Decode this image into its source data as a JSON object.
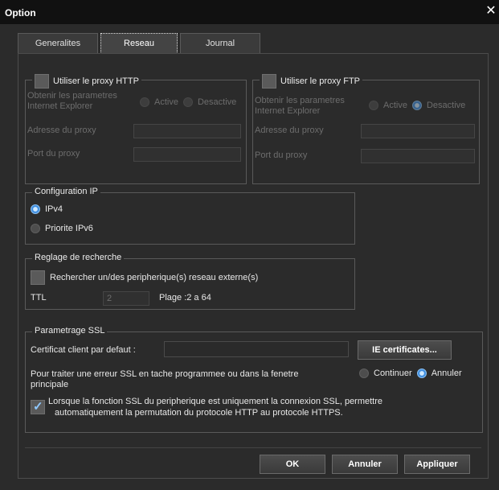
{
  "window": {
    "title": "Option",
    "close_glyph": "✕"
  },
  "tabs": [
    {
      "label": "Generalites"
    },
    {
      "label": "Reseau"
    },
    {
      "label": "Journal"
    }
  ],
  "proxy_http": {
    "checkbox_label": "Utiliser le proxy HTTP",
    "obtain_label_1": "Obtenir les parametres",
    "obtain_label_2": "Internet Explorer",
    "active_label": "Active",
    "desactive_label": "Desactive",
    "address_label": "Adresse du proxy",
    "port_label": "Port du proxy"
  },
  "proxy_ftp": {
    "checkbox_label": "Utiliser le proxy FTP",
    "obtain_label_1": "Obtenir les parametres",
    "obtain_label_2": "Internet Explorer",
    "active_label": "Active",
    "desactive_label": "Desactive",
    "address_label": "Adresse du proxy",
    "port_label": "Port du proxy"
  },
  "ip_config": {
    "legend": "Configuration IP",
    "ipv4_label": "IPv4",
    "ipv6_label": "Priorite IPv6"
  },
  "search": {
    "legend": "Reglage de recherche",
    "external_label": "Rechercher un/des peripherique(s) reseau externe(s)",
    "ttl_label": "TTL",
    "ttl_value": "2",
    "range_label": "Plage :2 a 64"
  },
  "ssl": {
    "legend": "Parametrage SSL",
    "cert_label": "Certificat client par defaut :",
    "ie_button": "IE certificates...",
    "error_label_1": "Pour traiter une erreur SSL en tache programmee ou dans la fenetre",
    "error_label_2": "principale",
    "continue_label": "Continuer",
    "cancel_label": "Annuler",
    "auto_label_1": "Lorsque la fonction SSL du peripherique est uniquement la connexion SSL, permettre",
    "auto_label_2": "automatiquement la permutation du protocole HTTP au protocole HTTPS."
  },
  "footer": {
    "ok_label": "OK",
    "cancel_label": "Annuler",
    "apply_label": "Appliquer"
  },
  "colors": {
    "accent": "#3f8ee0",
    "background": "#2b2b2b",
    "titlebar": "#111111"
  }
}
